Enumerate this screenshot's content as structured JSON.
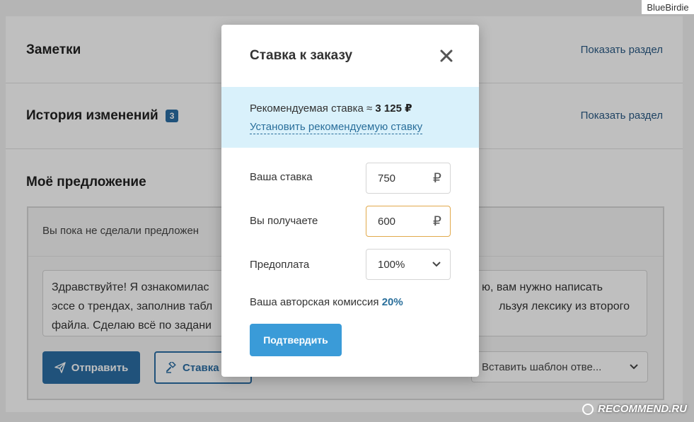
{
  "watermarks": {
    "top": "BlueBirdie",
    "bottom": "RECOMMEND.RU"
  },
  "sections": {
    "notes": {
      "title": "Заметки",
      "link": "Показать раздел"
    },
    "history": {
      "title": "История изменений",
      "badge": "3",
      "link": "Показать раздел"
    },
    "offer": {
      "title": "Моё предложение",
      "note": "Вы пока не сделали предложен",
      "message_lines": [
        "Здравствуйте! Я ознакомилас",
        "эссе о трендах, заполнив табл",
        "файла. Сделаю всё по задани",
        "ю, вам нужно написать",
        "льзуя лексику из второго"
      ],
      "send_label": "Отправить",
      "rate_label": "Ставка",
      "template_placeholder": "Вставить шаблон отве..."
    }
  },
  "modal": {
    "title": "Ставка к заказу",
    "recommended_prefix": "Рекомендуемая ставка ≈ ",
    "recommended_value": "3 125 ₽",
    "set_recommended_link": "Установить рекомендуемую ставку",
    "fields": {
      "bid": {
        "label": "Ваша ставка",
        "value": "750",
        "currency": "₽"
      },
      "receive": {
        "label": "Вы получаете",
        "value": "600",
        "currency": "₽"
      },
      "prepay": {
        "label": "Предоплата",
        "value": "100%"
      }
    },
    "commission_prefix": "Ваша авторская комиссия ",
    "commission_value": "20%",
    "confirm_label": "Подтвердить"
  },
  "colors": {
    "accent": "#2b6ea4",
    "confirm": "#3a9bd8",
    "recommend_bg": "#d9f1fb",
    "focus_border": "#e1a94b"
  }
}
